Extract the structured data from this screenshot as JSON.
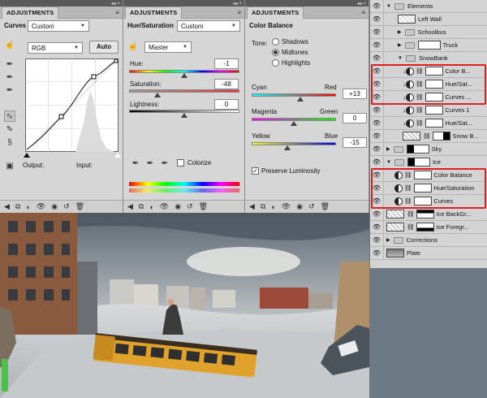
{
  "curves": {
    "tab": "ADJUSTMENTS",
    "title": "Curves",
    "preset": "Custom",
    "channel": "RGB",
    "auto": "Auto",
    "output": "Output:",
    "input": "Input:"
  },
  "hue": {
    "tab": "ADJUSTMENTS",
    "title": "Hue/Saturation",
    "preset": "Custom",
    "range": "Master",
    "hue_label": "Hue:",
    "hue_value": "-1",
    "sat_label": "Saturation:",
    "sat_value": "-48",
    "light_label": "Lightness:",
    "light_value": "0",
    "colorize": "Colorize"
  },
  "balance": {
    "tab": "ADJUSTMENTS",
    "title": "Color Balance",
    "tone": "Tone:",
    "shadows": "Shadows",
    "midtones": "Midtones",
    "highlights": "Highlights",
    "cyan": "Cyan",
    "red": "Red",
    "cyan_value": "+13",
    "magenta": "Magenta",
    "green": "Green",
    "magenta_value": "0",
    "yellow": "Yellow",
    "blue": "Blue",
    "yellow_value": "-15",
    "preserve": "Preserve Luminosity"
  },
  "layers": [
    {
      "name": "Elements"
    },
    {
      "name": "Left Wall"
    },
    {
      "name": "Schoolbus"
    },
    {
      "name": "Truck"
    },
    {
      "name": "SnowBank"
    },
    {
      "name": "Color B..."
    },
    {
      "name": "Hue/Sat..."
    },
    {
      "name": "Curves ..."
    },
    {
      "name": "Curves 1"
    },
    {
      "name": "Hue/Sat..."
    },
    {
      "name": "Snow B..."
    },
    {
      "name": "Sky"
    },
    {
      "name": "Ice"
    },
    {
      "name": "Color Balance"
    },
    {
      "name": "Hue/Saturation"
    },
    {
      "name": "Curves"
    },
    {
      "name": "Ice BackGr..."
    },
    {
      "name": "Ice Foregr..."
    },
    {
      "name": "Corrections"
    },
    {
      "name": "Plate"
    }
  ],
  "colors": {
    "highlight": "#e02020",
    "panel": "#d6d6d6"
  }
}
